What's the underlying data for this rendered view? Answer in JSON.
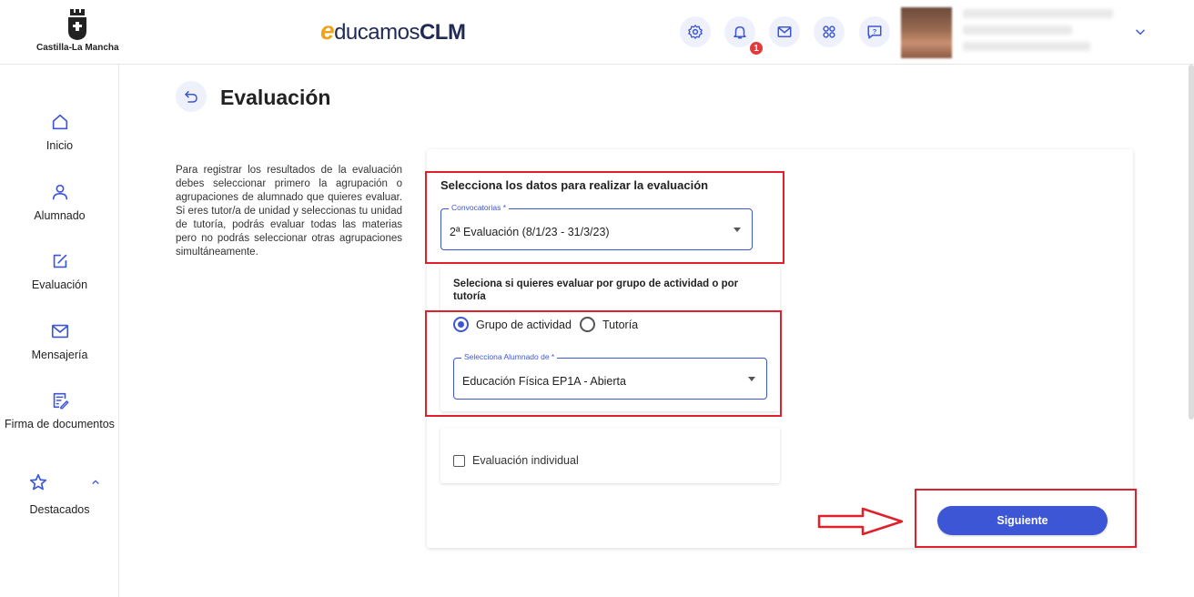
{
  "header": {
    "org_name": "Castilla-La Mancha",
    "brand_prefix": "e",
    "brand_name": "ducamos",
    "brand_suffix": "CLM",
    "notification_count": "1",
    "icons": [
      "gear-icon",
      "bell-icon",
      "mail-icon",
      "apps-icon",
      "help-icon",
      "chevron-down-icon"
    ]
  },
  "sidebar": {
    "items": [
      {
        "label": "Inicio",
        "icon": "home-icon"
      },
      {
        "label": "Alumnado",
        "icon": "person-icon"
      },
      {
        "label": "Evaluación",
        "icon": "edit-square-icon"
      },
      {
        "label": "Mensajería",
        "icon": "mail-icon"
      },
      {
        "label": "Firma de documentos",
        "icon": "document-sign-icon"
      },
      {
        "label": "Destacados",
        "icon": "star-icon"
      }
    ]
  },
  "page": {
    "title": "Evaluación",
    "intro": "Para registrar los resultados de la evaluación debes seleccionar primero la agrupación o agrupaciones de alumnado que quieres evaluar. Si eres tutor/a de unidad y seleccionas tu unidad de tutoría, podrás evaluar todas las materias pero no podrás seleccionar otras agrupaciones simultáneamente."
  },
  "form": {
    "section_title": "Selecciona los datos para realizar la evaluación",
    "convocatorias": {
      "label": "Convocatorias *",
      "value": "2ª Evaluación (8/1/23 - 31/3/23)"
    },
    "mode_title": "Seleciona si quieres evaluar por grupo de actividad o por tutoría",
    "mode_options": [
      {
        "label": "Grupo de actividad",
        "selected": true
      },
      {
        "label": "Tutoría",
        "selected": false
      }
    ],
    "alumnado": {
      "label": "Selecciona Alumnado de *",
      "value": "Educación Física EP1A - Abierta"
    },
    "individual": {
      "label": "Evaluación individual",
      "checked": false
    },
    "next_label": "Siguiente"
  },
  "colors": {
    "accent": "#3d56d6",
    "annotation_red": "#e0202a",
    "brand_orange": "#f2a31b",
    "brand_navy": "#1f2a55",
    "notification_red": "#e23b3b"
  }
}
